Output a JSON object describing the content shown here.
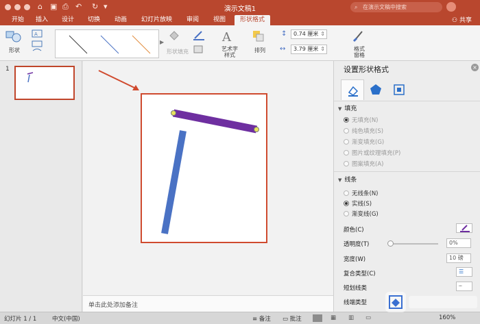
{
  "window": {
    "title": "演示文稿1"
  },
  "search": {
    "placeholder": "在演示文稿中搜索"
  },
  "share_label": "共享",
  "tabs": [
    "开始",
    "插入",
    "设计",
    "切换",
    "动画",
    "幻灯片放映",
    "审阅",
    "视图",
    "形状格式"
  ],
  "ribbon": {
    "shapes_label": "形状",
    "shape_fill_label": "形状填充",
    "wordart_label": "艺术字\n样式",
    "arrange_label": "排列",
    "height_value": "0.74 厘米",
    "width_value": "3.79 厘米",
    "format_pane_label": "格式\n窗格"
  },
  "thumb_panel": {
    "slide_number": "1"
  },
  "notes_placeholder": "单击此处添加备注",
  "pane": {
    "title": "设置形状格式",
    "fill_section": "填充",
    "fill_options": [
      "无填充(N)",
      "纯色填充(S)",
      "渐变填充(G)",
      "图片或纹理填充(P)",
      "图案填充(A)"
    ],
    "line_section": "线条",
    "line_options": [
      "无线条(N)",
      "实线(S)",
      "渐变线(G)"
    ],
    "color_label": "颜色(C)",
    "transparency_label": "透明度(T)",
    "transparency_value": "0%",
    "width_label": "宽度(W)",
    "width_value": "10 磅",
    "compound_label": "复合类型(C)",
    "dash_label": "短划线类",
    "cap_label": "线端类型"
  },
  "status": {
    "slide_info": "幻灯片 1 / 1",
    "language": "中文(中国)",
    "notes_btn": "备注",
    "comments_btn": "批注",
    "zoom": "160%"
  },
  "colors": {
    "brand": "#b9472e",
    "purple_line": "#6e2fa0",
    "blue_line": "#4a72c4",
    "selection_red": "#cf4a2e"
  }
}
